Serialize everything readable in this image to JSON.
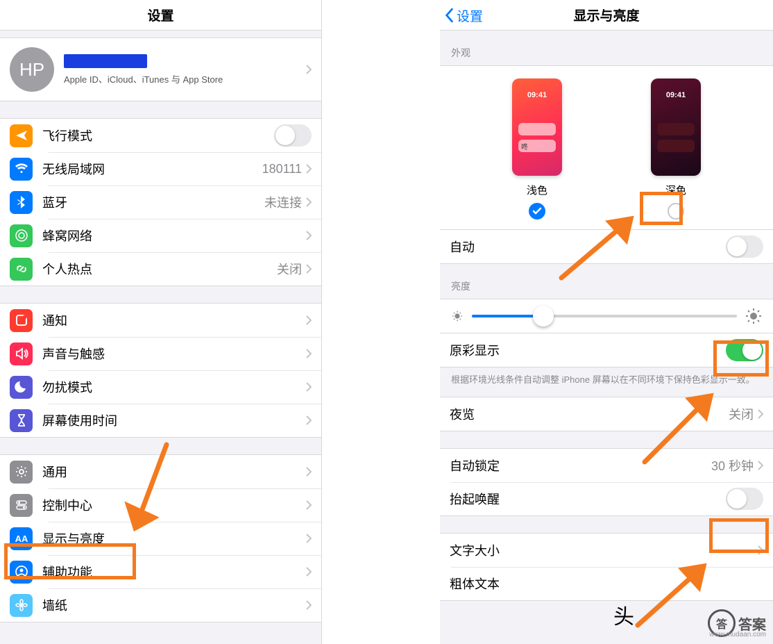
{
  "left": {
    "title": "设置",
    "avatar_initials": "HP",
    "apple_id_sub": "Apple ID、iCloud、iTunes 与 App Store",
    "rows": {
      "airplane": "飞行模式",
      "wifi": "无线局域网",
      "wifi_val": "180111",
      "bluetooth": "蓝牙",
      "bluetooth_val": "未连接",
      "cellular": "蜂窝网络",
      "hotspot": "个人热点",
      "hotspot_val": "关闭",
      "notifications": "通知",
      "sounds": "声音与触感",
      "dnd": "勿扰模式",
      "screentime": "屏幕使用时间",
      "general": "通用",
      "control": "控制中心",
      "display": "显示与亮度",
      "accessibility": "辅助功能",
      "wallpaper": "墙纸"
    }
  },
  "right": {
    "back": "设置",
    "title": "显示与亮度",
    "appearance_hdr": "外观",
    "light": "浅色",
    "dark": "深色",
    "thumb_time": "09:41",
    "auto": "自动",
    "brightness_hdr": "亮度",
    "truetone": "原彩显示",
    "truetone_note": "根据环境光线条件自动调整 iPhone 屏幕以在不同环境下保持色彩显示一致。",
    "nightshift": "夜览",
    "nightshift_val": "关闭",
    "autolock": "自动锁定",
    "autolock_val": "30 秒钟",
    "raise": "抬起唤醒",
    "textsize": "文字大小",
    "bold": "粗体文本"
  },
  "watermark": {
    "circle": "答",
    "text": "答案",
    "url": "www.mudaan.com",
    "headline": "头"
  }
}
